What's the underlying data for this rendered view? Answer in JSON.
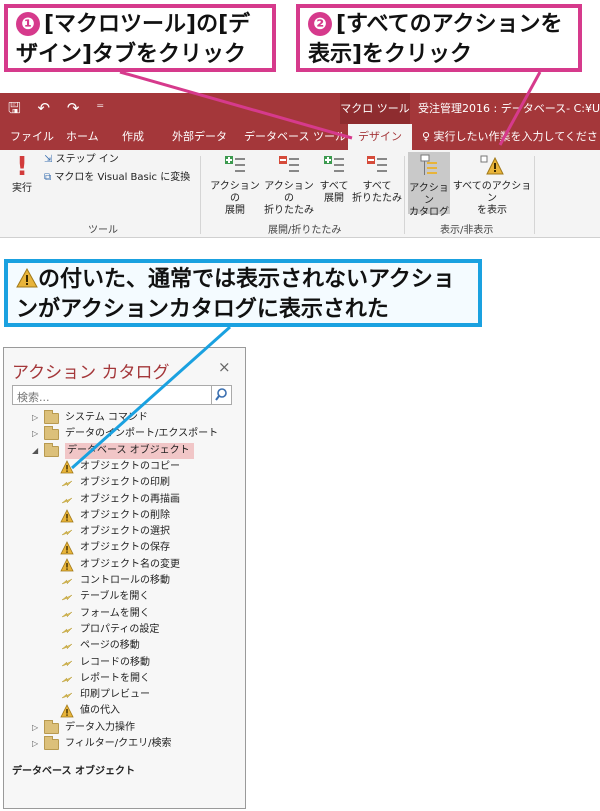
{
  "callouts": {
    "step1_number": "❶",
    "step1_text": "[マクロツール]の[デザイン]タブをクリック",
    "step2_number": "❷",
    "step2_text": "[すべてのアクションを表示]をクリック",
    "note_text": "の付いた、通常では表示されないアクションがアクションカタログに表示された"
  },
  "titlebar": {
    "quick_access": "🖫 ↶ ↷ ⁼",
    "context_tool": "マクロ ツール",
    "document_title": "受注管理2016 : データベース- C:¥U"
  },
  "tabs": {
    "file": "ファイル",
    "home": "ホーム",
    "create": "作成",
    "external_data": "外部データ",
    "database_tools": "データベース ツール",
    "design": "デザイン",
    "tell_me": "♀ 実行したい作業を入力してくださ"
  },
  "ribbon": {
    "run_label": "実行",
    "step_in_label": "ステップ イン",
    "convert_label": "マクロを Visual Basic に変換",
    "tools_group": "ツール",
    "expand_action": [
      "アクションの",
      "展開"
    ],
    "collapse_action": [
      "アクションの",
      "折りたたみ"
    ],
    "expand_all": [
      "すべて",
      "展開"
    ],
    "collapse_all": [
      "すべて",
      "折りたたみ"
    ],
    "expand_collapse_group": "展開/折りたたみ",
    "action_catalog": [
      "アクション",
      "カタログ"
    ],
    "show_all_actions": [
      "すべてのアクション",
      "を表示"
    ],
    "show_hide_group": "表示/非表示"
  },
  "pane": {
    "title": "アクション カタログ",
    "close": "×",
    "search_placeholder": "検索...",
    "folders_top": [
      "システム コマンド",
      "データのインポート/エクスポート"
    ],
    "selected_folder": "データベース オブジェクト",
    "actions": [
      {
        "label": "オブジェクトのコピー",
        "warning": true
      },
      {
        "label": "オブジェクトの印刷",
        "warning": false
      },
      {
        "label": "オブジェクトの再描画",
        "warning": false
      },
      {
        "label": "オブジェクトの削除",
        "warning": true
      },
      {
        "label": "オブジェクトの選択",
        "warning": false
      },
      {
        "label": "オブジェクトの保存",
        "warning": true
      },
      {
        "label": "オブジェクト名の変更",
        "warning": true
      },
      {
        "label": "コントロールの移動",
        "warning": false
      },
      {
        "label": "テーブルを開く",
        "warning": false
      },
      {
        "label": "フォームを開く",
        "warning": false
      },
      {
        "label": "プロパティの設定",
        "warning": false
      },
      {
        "label": "ページの移動",
        "warning": false
      },
      {
        "label": "レコードの移動",
        "warning": false
      },
      {
        "label": "レポートを開く",
        "warning": false
      },
      {
        "label": "印刷プレビュー",
        "warning": false
      },
      {
        "label": "値の代入",
        "warning": true
      }
    ],
    "folders_bottom": [
      "データ入力操作",
      "フィルター/クエリ/検索"
    ],
    "footer": "データベース オブジェクト"
  },
  "colors": {
    "access_red": "#a4373a",
    "callout_pink": "#d63a8c",
    "callout_blue": "#1aa1e0",
    "warning_yellow": "#e8b43a"
  }
}
